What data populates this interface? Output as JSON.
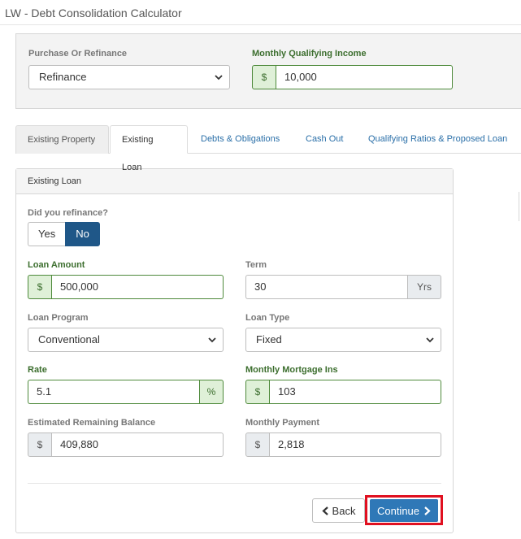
{
  "app": {
    "title": "LW - Debt Consolidation Calculator"
  },
  "top": {
    "purchase_label": "Purchase Or Refinance",
    "purchase_value": "Refinance",
    "income_label": "Monthly Qualifying Income",
    "income_prefix": "$",
    "income_value": "10,000"
  },
  "tabs": [
    {
      "label": "Existing Property"
    },
    {
      "label": "Existing Loan"
    },
    {
      "label": "Debts & Obligations"
    },
    {
      "label": "Cash Out"
    },
    {
      "label": "Qualifying Ratios & Proposed Loan"
    }
  ],
  "card": {
    "header": "Existing Loan",
    "refinance_label": "Did you refinance?",
    "yes_label": "Yes",
    "no_label": "No",
    "loan_amount_label": "Loan Amount",
    "loan_amount_prefix": "$",
    "loan_amount_value": "500,000",
    "term_label": "Term",
    "term_value": "30",
    "term_suffix": "Yrs",
    "loan_program_label": "Loan Program",
    "loan_program_value": "Conventional",
    "loan_type_label": "Loan Type",
    "loan_type_value": "Fixed",
    "rate_label": "Rate",
    "rate_value": "5.1",
    "rate_suffix": "%",
    "mmi_label": "Monthly Mortgage Ins",
    "mmi_prefix": "$",
    "mmi_value": "103",
    "erb_label": "Estimated Remaining Balance",
    "erb_prefix": "$",
    "erb_value": "409,880",
    "payment_label": "Monthly Payment",
    "payment_prefix": "$",
    "payment_value": "2,818"
  },
  "buttons": {
    "back": "Back",
    "continue": "Continue"
  },
  "colors": {
    "accent": "#2f78b7",
    "success": "#4e8a3b",
    "highlight": "#e01020",
    "toggle_on": "#1f5788"
  },
  "icons": {
    "select": "chevron-down-icon",
    "back": "chevron-left-icon",
    "continue": "chevron-right-icon"
  }
}
